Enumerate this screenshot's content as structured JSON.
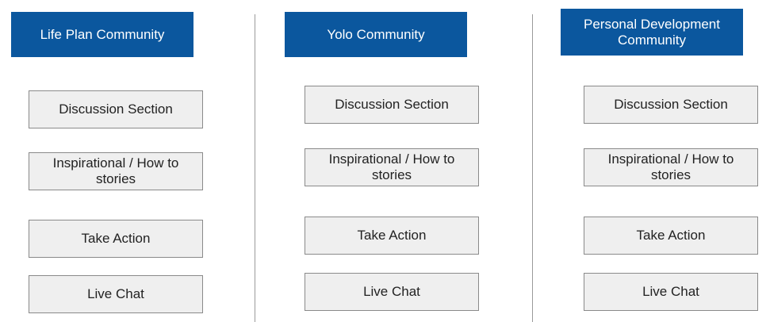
{
  "columns": [
    {
      "header": "Life Plan Community",
      "items": [
        "Discussion Section",
        "Inspirational / How to stories",
        "Take Action",
        "Live Chat"
      ]
    },
    {
      "header": "Yolo Community",
      "items": [
        "Discussion Section",
        "Inspirational / How to stories",
        "Take Action",
        "Live Chat"
      ]
    },
    {
      "header": "Personal Development Community",
      "items": [
        "Discussion Section",
        "Inspirational / How to stories",
        "Take Action",
        "Live Chat"
      ]
    }
  ],
  "colors": {
    "header_bg": "#0b579e",
    "header_text": "#ffffff",
    "box_bg": "#efefef",
    "box_border": "#8a8a8a",
    "divider": "#9a9a9a"
  }
}
